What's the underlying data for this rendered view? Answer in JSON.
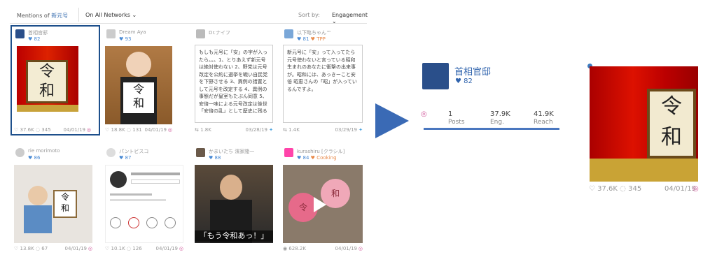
{
  "topbar": {
    "mentions_prefix": "Mentions of",
    "mentions_term": "新元号",
    "network": "On All Networks",
    "sort_label": "Sort by:",
    "sort_value": "Engagement"
  },
  "cards": [
    {
      "name": "首相官邸",
      "reach": "82",
      "tag": "",
      "likes": "37.6K",
      "comments": "345",
      "date": "04/01/19",
      "net": "instagram-icon",
      "text": ""
    },
    {
      "name": "Dream Aya",
      "reach": "93",
      "tag": "",
      "likes": "18.8K",
      "comments": "131",
      "date": "04/01/19",
      "net": "instagram-icon",
      "text": ""
    },
    {
      "name": "Dr.ナイフ",
      "reach": "",
      "tag": "",
      "likes": "1.8K",
      "comments": "",
      "date": "03/28/19",
      "net": "twitter-icon",
      "text": "もしも元号に「安」の字が入ったら。。。1、とりあえず新元号は絶対使わない 2、野党は元号改定を公約に選挙を戦い自民党を下野させる 3、異例の措置として元号を改定する 4、異例の事態だが皇室もたぶん同意 5、安倍一味による元号改定は後世「安倍の乱」として歴史に残る"
    },
    {
      "name": "以下略ちゃん™",
      "reach": "81",
      "tag": "TPP",
      "likes": "1.4K",
      "comments": "",
      "date": "03/29/19",
      "net": "twitter-icon",
      "text": "新元号に「安」って入ってたら元号使わないと言っている昭和生まれのあなたに衝撃の出来事が。昭和には、あっきーこと安倍 昭恵さんの「昭」が入っているんですよ。"
    },
    {
      "name": "rie morimoto",
      "reach": "86",
      "tag": "",
      "likes": "13.8K",
      "comments": "67",
      "date": "04/01/19",
      "net": "instagram-icon",
      "text": ""
    },
    {
      "name": "パントビスコ",
      "reach": "87",
      "tag": "",
      "likes": "10.1K",
      "comments": "126",
      "date": "04/01/19",
      "net": "instagram-icon",
      "text": ""
    },
    {
      "name": "かまいたち 濱家隆一",
      "reach": "88",
      "tag": "",
      "likes": "",
      "comments": "",
      "date": "",
      "net": "",
      "text": ""
    },
    {
      "name": "kurashiru [クラシル]",
      "reach": "84",
      "tag": "Cooking",
      "likes": "628.2K",
      "comments": "",
      "date": "04/01/19",
      "net": "instagram-icon",
      "text": ""
    }
  ],
  "detail": {
    "name": "首相官邸",
    "reach_score": "82",
    "stats": [
      {
        "value": "1",
        "label": "Posts"
      },
      {
        "value": "37.9K",
        "label": "Eng."
      },
      {
        "value": "41.9K",
        "label": "Reach"
      }
    ],
    "likes": "37.6K",
    "comments": "345",
    "date": "04/01/19",
    "calligraphy": [
      "令",
      "和"
    ]
  },
  "misc": {
    "reiwa_line": "もう令和あっ！",
    "icons": {
      "heart": "♥",
      "comment": "◌",
      "retweet": "⇆",
      "eye": "◉"
    }
  },
  "colors": {
    "accent": "#3a6ab5",
    "instagram": "#d0569a",
    "twitter": "#4aa3df"
  }
}
